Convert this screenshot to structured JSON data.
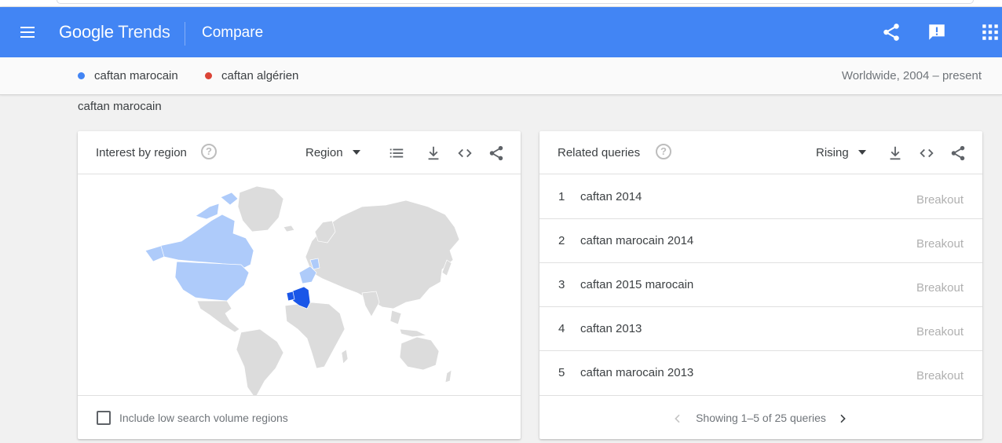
{
  "app": {
    "logo_google": "Google",
    "logo_trends": "Trends",
    "page_title": "Compare",
    "brand_color": "#4285f4"
  },
  "topbar_icons": [
    "menu-icon",
    "share-icon",
    "feedback-icon",
    "apps-grid-icon"
  ],
  "compare": {
    "terms": [
      {
        "label": "caftan marocain",
        "color": "#4285f4"
      },
      {
        "label": "caftan algérien",
        "color": "#db4437"
      }
    ],
    "scope": "Worldwide, 2004 – present"
  },
  "section_label": "caftan marocain",
  "region_card": {
    "title": "Interest by region",
    "resolution": "Region",
    "icons": [
      "help-icon",
      "list-view-icon",
      "download-icon",
      "embed-code-icon",
      "share-icon"
    ],
    "checkbox_label": "Include low search volume regions",
    "map_colors": {
      "land": "#dcdcdc",
      "low": "#aecbfa",
      "high": "#1a56e8"
    }
  },
  "queries_card": {
    "title": "Related queries",
    "mode": "Rising",
    "icons": [
      "help-icon",
      "download-icon",
      "embed-code-icon",
      "share-icon"
    ],
    "rows": [
      {
        "rank": "1",
        "query": "caftan 2014",
        "value": "Breakout"
      },
      {
        "rank": "2",
        "query": "caftan marocain 2014",
        "value": "Breakout"
      },
      {
        "rank": "3",
        "query": "caftan 2015 marocain",
        "value": "Breakout"
      },
      {
        "rank": "4",
        "query": "caftan 2013",
        "value": "Breakout"
      },
      {
        "rank": "5",
        "query": "caftan marocain 2013",
        "value": "Breakout"
      }
    ],
    "pager": "Showing 1–5 of 25 queries"
  }
}
